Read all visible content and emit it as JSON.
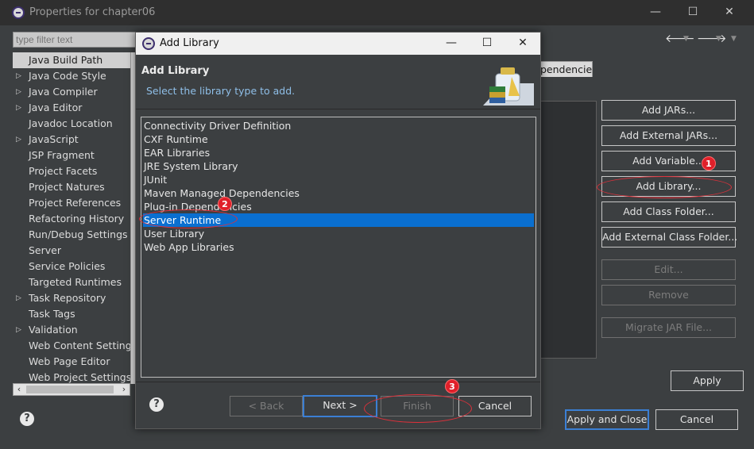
{
  "outer": {
    "title": "Properties for chapter06",
    "filter_placeholder": "type filter text",
    "nav_items": [
      {
        "label": "Java Build Path",
        "selected": true,
        "expandable": false
      },
      {
        "label": "Java Code Style",
        "expandable": true
      },
      {
        "label": "Java Compiler",
        "expandable": true
      },
      {
        "label": "Java Editor",
        "expandable": true
      },
      {
        "label": "Javadoc Location",
        "expandable": false
      },
      {
        "label": "JavaScript",
        "expandable": true
      },
      {
        "label": "JSP Fragment",
        "expandable": false
      },
      {
        "label": "Project Facets",
        "expandable": false
      },
      {
        "label": "Project Natures",
        "expandable": false
      },
      {
        "label": "Project References",
        "expandable": false
      },
      {
        "label": "Refactoring History",
        "expandable": false
      },
      {
        "label": "Run/Debug Settings",
        "expandable": false
      },
      {
        "label": "Server",
        "expandable": false
      },
      {
        "label": "Service Policies",
        "expandable": false
      },
      {
        "label": "Targeted Runtimes",
        "expandable": false
      },
      {
        "label": "Task Repository",
        "expandable": true
      },
      {
        "label": "Task Tags",
        "expandable": false
      },
      {
        "label": "Validation",
        "expandable": true
      },
      {
        "label": "Web Content Settings",
        "expandable": false
      },
      {
        "label": "Web Page Editor",
        "expandable": false
      },
      {
        "label": "Web Project Settings",
        "expandable": false
      }
    ],
    "tab_partial": "pendencies",
    "buttons": {
      "add_jars": "Add JARs...",
      "add_external_jars": "Add External JARs...",
      "add_variable": "Add Variable...",
      "add_library": "Add Library...",
      "add_class_folder": "Add Class Folder...",
      "add_external_class_folder": "Add External Class Folder...",
      "edit": "Edit...",
      "remove": "Remove",
      "migrate_jar": "Migrate JAR File...",
      "apply": "Apply",
      "apply_and_close": "Apply and Close",
      "cancel": "Cancel"
    },
    "help_glyph": "?"
  },
  "dialog": {
    "title": "Add Library",
    "heading": "Add Library",
    "subtitle": "Select the library type to add.",
    "libraries": [
      "Connectivity Driver Definition",
      "CXF Runtime",
      "EAR Libraries",
      "JRE System Library",
      "JUnit",
      "Maven Managed Dependencies",
      "Plug-in Dependencies",
      "Server Runtime",
      "User Library",
      "Web App Libraries"
    ],
    "selected_library": "Server Runtime",
    "buttons": {
      "back": "< Back",
      "next": "Next >",
      "finish": "Finish",
      "cancel": "Cancel"
    },
    "help_glyph": "?"
  },
  "annotations": {
    "badge_1": "1",
    "badge_2": "2",
    "badge_3": "3"
  },
  "colors": {
    "selection": "#0a6fd0",
    "annotation": "#e0202a",
    "default_button_border": "#3b7fd4"
  }
}
